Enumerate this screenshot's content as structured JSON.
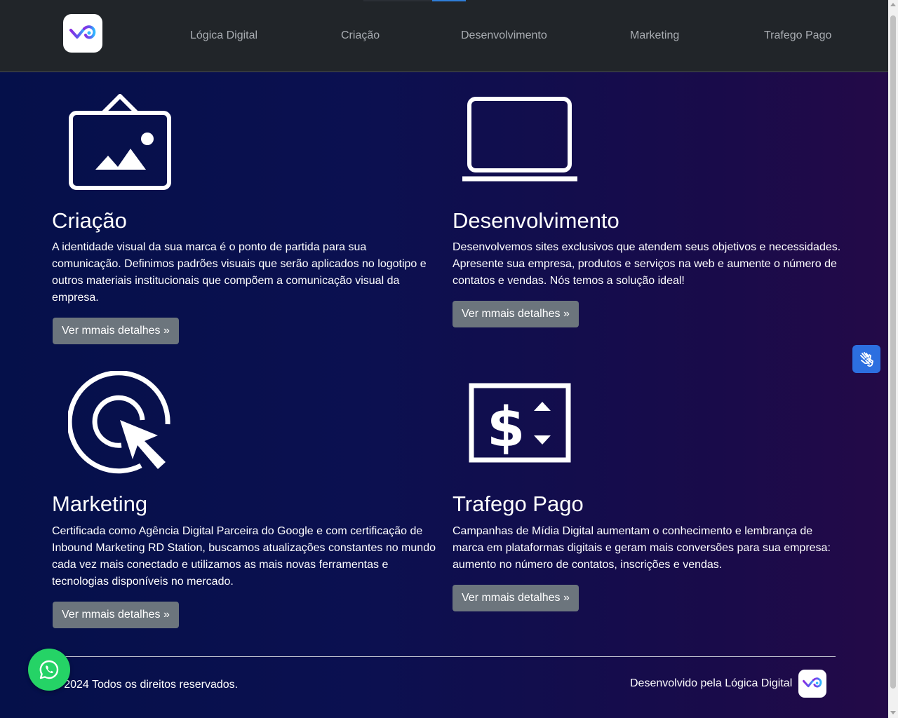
{
  "nav": {
    "logo_icon": "logica-digital-logo",
    "links": [
      "Lógica Digital",
      "Criação",
      "Desenvolvimento",
      "Marketing",
      "Trafego Pago"
    ]
  },
  "services": [
    {
      "icon": "image-frame-icon",
      "title": "Criação",
      "text": "A identidade visual da sua marca é o ponto de partida para sua comunicação. Definimos padrões visuais que serão aplicados no logotipo e outros materiais institucionais que compõem a comunicação visual da empresa.",
      "button": "Ver mmais detalhes »"
    },
    {
      "icon": "laptop-icon",
      "title": "Desenvolvimento",
      "text": "Desenvolvemos sites exclusivos que atendem seus objetivos e necessidades. Apresente sua empresa, produtos e serviços na web e aumente o número de contatos e vendas. Nós temos a solução ideal!",
      "button": "Ver mmais detalhes »"
    },
    {
      "icon": "target-cursor-icon",
      "title": "Marketing",
      "text": "Certificada como Agência Digital Parceira do Google e com certificação de Inbound Marketing RD Station, buscamos atualizações constantes no mundo cada vez mais conectado e utilizamos as mais novas ferramentas e tecnologias disponíveis no mercado.",
      "button": "Ver mmais detalhes »"
    },
    {
      "icon": "dollar-exchange-icon",
      "title": "Trafego Pago",
      "text": "Campanhas de Mídia Digital aumentam o conhecimento e lembrança de marca em plataformas digitais e geram mais conversões para sua empresa: aumento no número de contatos, inscrições e vendas.",
      "button": "Ver mmais detalhes »"
    }
  ],
  "footer": {
    "copyright": "© 2024 Todos os direitos reservados.",
    "developed_by": "Desenvolvido pela Lógica Digital"
  },
  "floating": {
    "whatsapp_icon": "whatsapp-icon",
    "accessibility_icon": "sign-language-hands-icon"
  },
  "colors": {
    "navbar": "#212529",
    "button": "#6c757d",
    "whatsapp": "#25d366",
    "accessibility": "#2c6fe0",
    "logo_gradient_start": "#7b3cff",
    "logo_gradient_end": "#2fb8ff"
  }
}
